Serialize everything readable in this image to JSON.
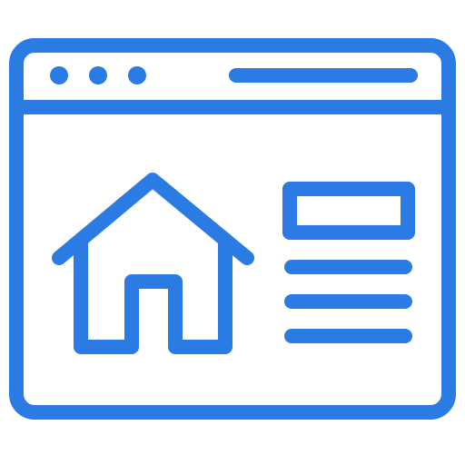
{
  "icon": {
    "name": "website-home-page-icon",
    "color": "#2a7be4",
    "parts": {
      "window": "browser-window-icon",
      "dots": "window-control-dots",
      "address_bar": "address-bar-line",
      "house": "home-icon",
      "content_box": "content-block",
      "text_lines": "text-line"
    }
  }
}
